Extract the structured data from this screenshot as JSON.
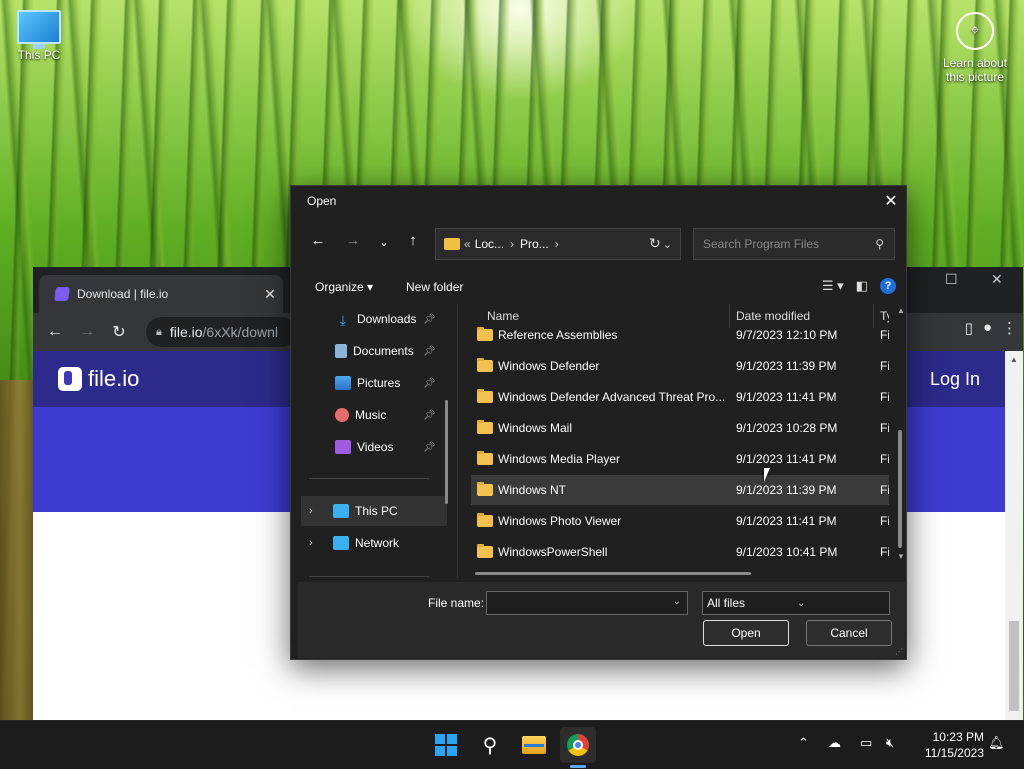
{
  "desktop": {
    "this_pc_label": "This PC",
    "learn_label_line1": "Learn about",
    "learn_label_line2": "this picture"
  },
  "browser": {
    "tab_title": "Download | file.io",
    "tab_close": "✕",
    "url_host": "file.io",
    "url_path": "/6xXk/downl",
    "site_logo": "file.io",
    "login_label": "Log In",
    "window_min": "─",
    "window_max": "☐",
    "window_close": "✕"
  },
  "dialog": {
    "title": "Open",
    "close": "✕",
    "address": {
      "prefix": "«",
      "crumb1": "Loc...",
      "crumb2": "Pro...",
      "sep": "›"
    },
    "search_placeholder": "Search Program Files",
    "organize_label": "Organize ▾",
    "new_folder_label": "New folder",
    "nav_items": [
      {
        "label": "Downloads",
        "icon": "download-icon",
        "color": "#3aa0f0",
        "pinned": true
      },
      {
        "label": "Documents",
        "icon": "document-icon",
        "color": "#8ab4d8",
        "pinned": true
      },
      {
        "label": "Pictures",
        "icon": "pictures-icon",
        "color": "#4aa8f0",
        "pinned": true
      },
      {
        "label": "Music",
        "icon": "music-icon",
        "color": "#e86a6a",
        "pinned": true
      },
      {
        "label": "Videos",
        "icon": "videos-icon",
        "color": "#a05ce0",
        "pinned": true
      },
      {
        "label": "This PC",
        "icon": "monitor-icon",
        "color": "#3ab0f0",
        "pinned": false
      },
      {
        "label": "Network",
        "icon": "network-icon",
        "color": "#3ab0f0",
        "pinned": false
      }
    ],
    "columns": {
      "name": "Name",
      "date": "Date modified",
      "type": "Ty"
    },
    "files": [
      {
        "name": "Reference Assemblies",
        "date": "9/7/2023 12:10 PM",
        "type": "Fi"
      },
      {
        "name": "Windows Defender",
        "date": "9/1/2023 11:39 PM",
        "type": "Fi"
      },
      {
        "name": "Windows Defender Advanced Threat Pro...",
        "date": "9/1/2023 11:41 PM",
        "type": "Fi"
      },
      {
        "name": "Windows Mail",
        "date": "9/1/2023 10:28 PM",
        "type": "Fi"
      },
      {
        "name": "Windows Media Player",
        "date": "9/1/2023 11:41 PM",
        "type": "Fi"
      },
      {
        "name": "Windows NT",
        "date": "9/1/2023 11:39 PM",
        "type": "Fi"
      },
      {
        "name": "Windows Photo Viewer",
        "date": "9/1/2023 11:41 PM",
        "type": "Fi"
      },
      {
        "name": "WindowsPowerShell",
        "date": "9/1/2023 10:41 PM",
        "type": "Fi"
      }
    ],
    "file_name_label": "File name:",
    "file_name_value": "",
    "file_type_value": "All files",
    "open_label": "Open",
    "cancel_label": "Cancel"
  },
  "taskbar": {
    "time": "10:23 PM",
    "date": "11/15/2023"
  }
}
